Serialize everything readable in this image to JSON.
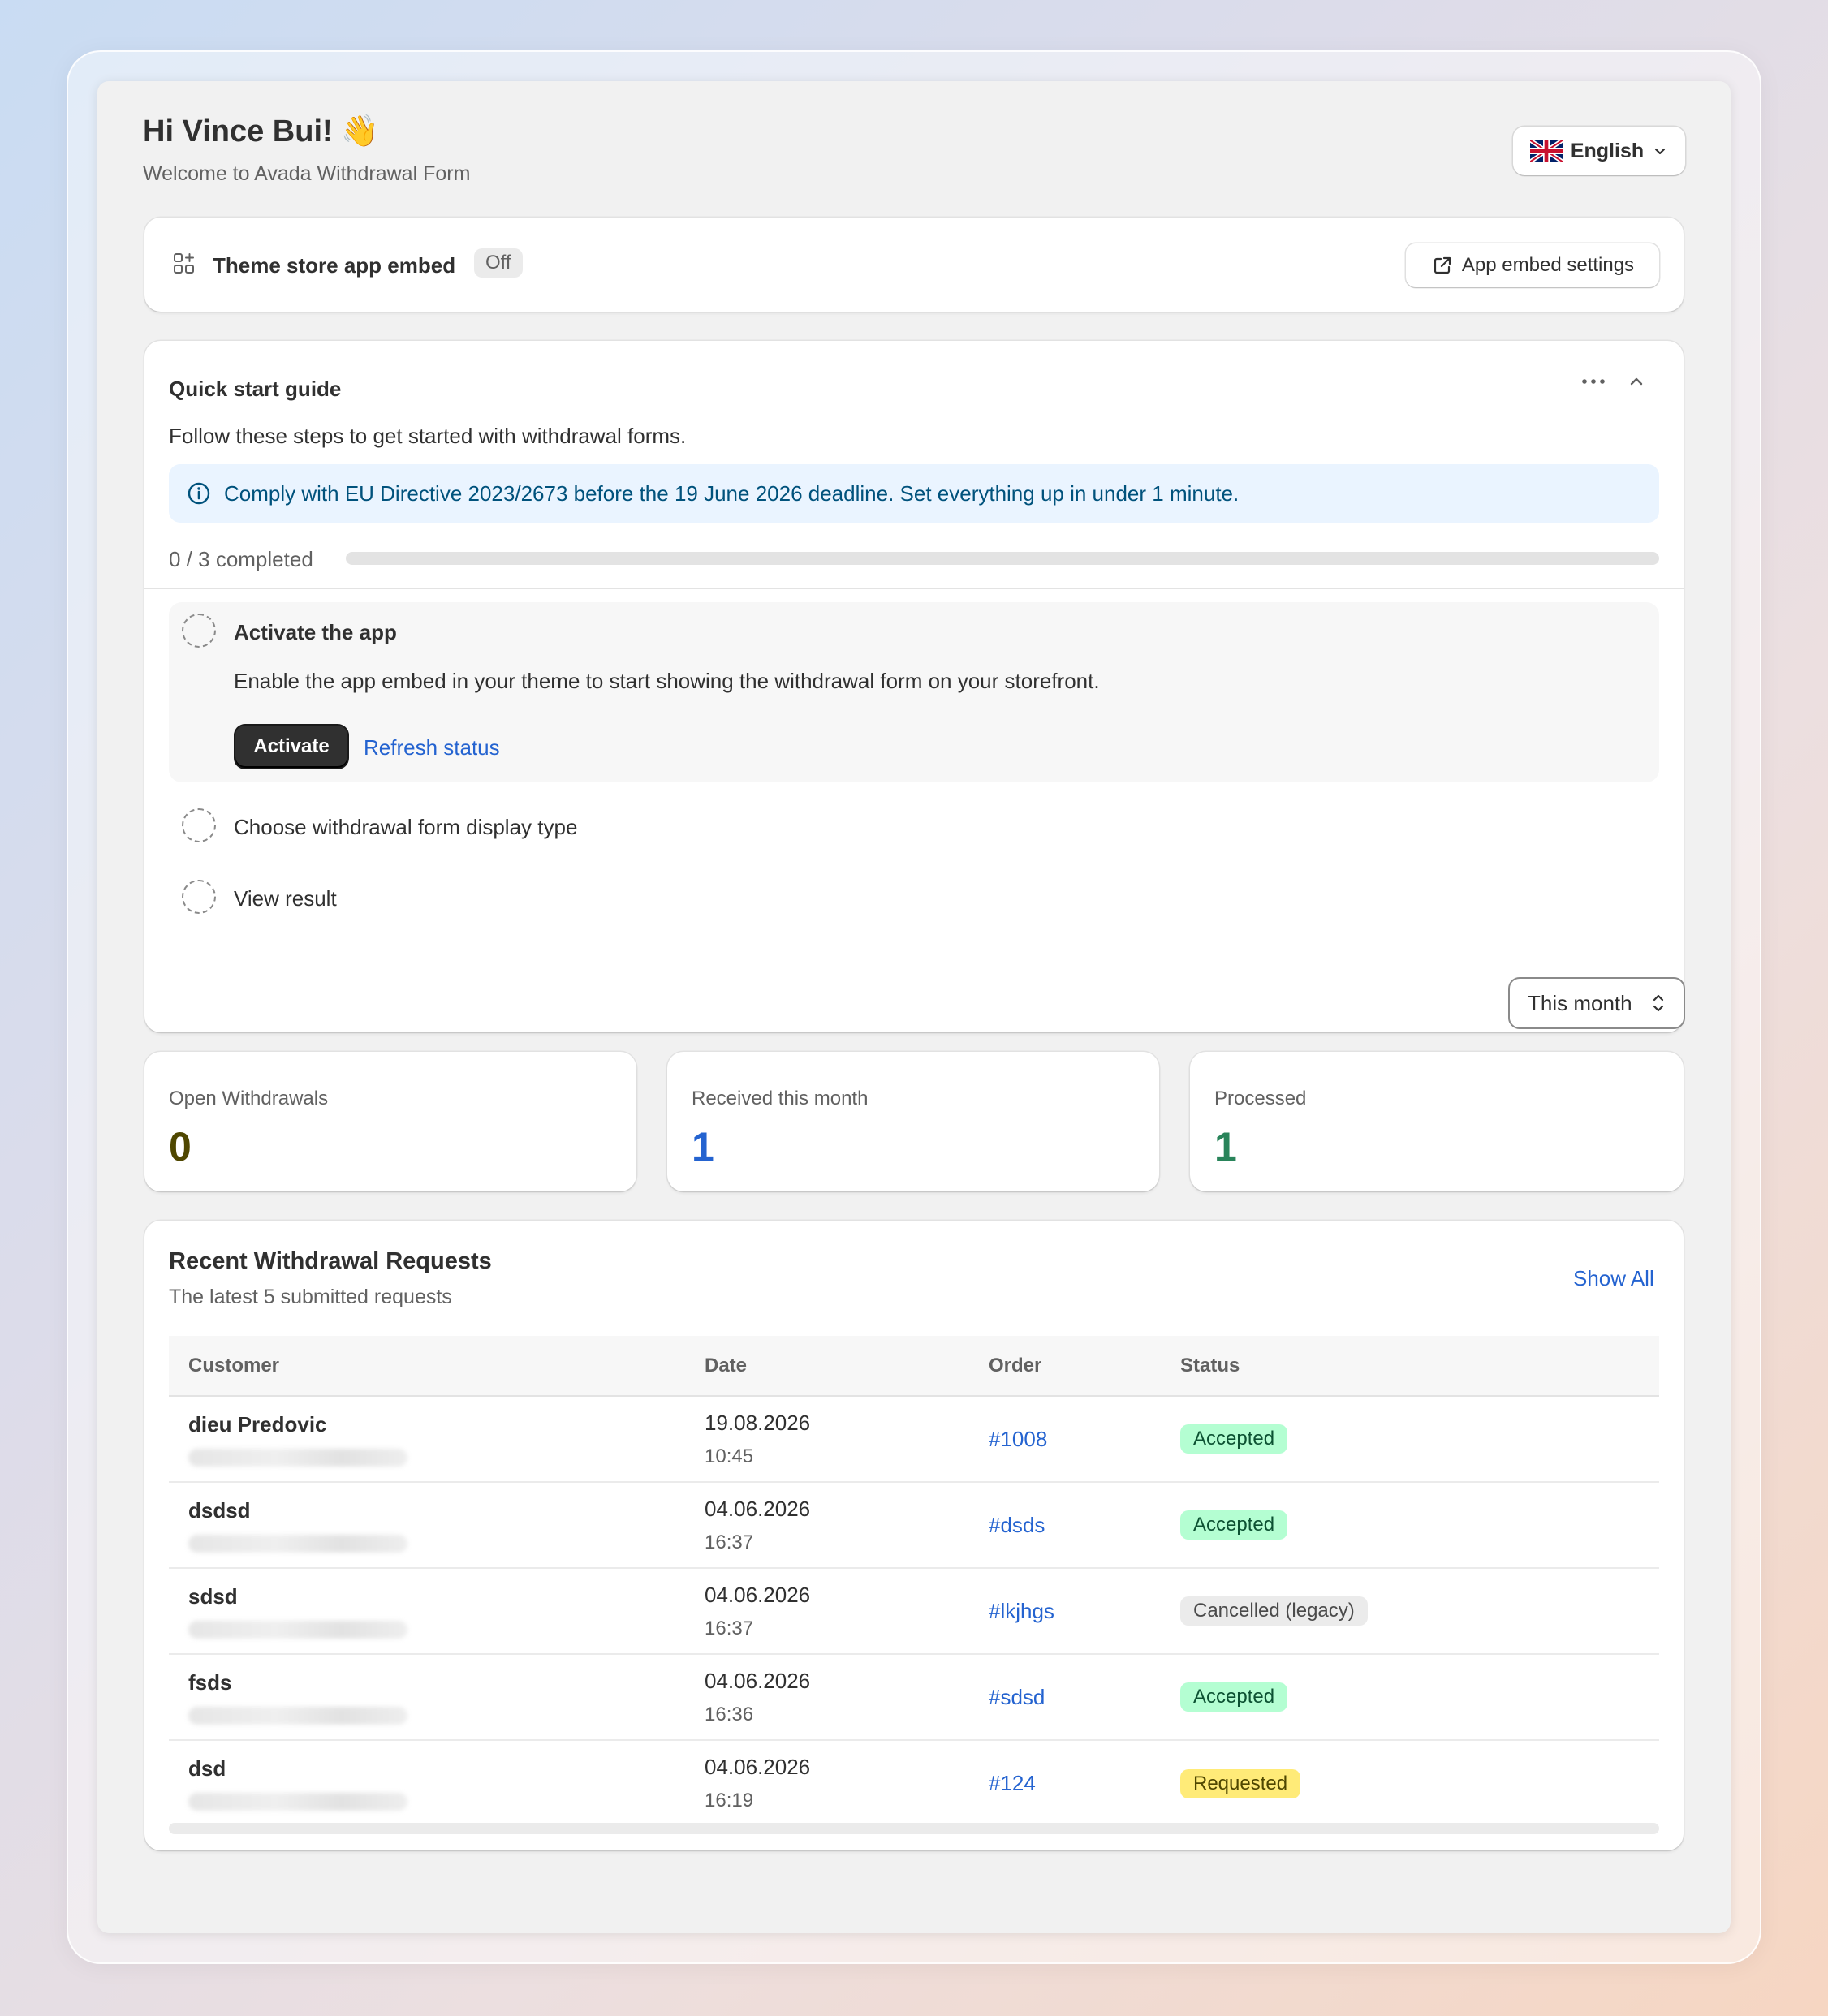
{
  "header": {
    "greeting": "Hi Vince Bui!",
    "greeting_emoji": "👋",
    "welcome": "Welcome to Avada Withdrawal Form",
    "language": "English",
    "language_icon": "uk-flag-icon"
  },
  "embed": {
    "title": "Theme store app embed",
    "status": "Off",
    "settings_label": "App embed settings"
  },
  "guide": {
    "title": "Quick start guide",
    "description": "Follow these steps to get started with withdrawal forms.",
    "banner": "Comply with EU Directive 2023/2673 before the 19 June 2026 deadline. Set everything up in under 1 minute.",
    "progress_text": "0 / 3 completed",
    "progress_completed": 0,
    "progress_total": 3,
    "steps": [
      {
        "title": "Activate the app",
        "description": "Enable the app embed in your theme to start showing the withdrawal form on your storefront.",
        "primary_action": "Activate",
        "secondary_action": "Refresh status"
      },
      {
        "title": "Choose withdrawal form display type"
      },
      {
        "title": "View result"
      }
    ]
  },
  "filter": {
    "period": "This month"
  },
  "stats": {
    "open": {
      "label": "Open Withdrawals",
      "value": "0",
      "color": "#4f4700"
    },
    "received": {
      "label": "Received this month",
      "value": "1",
      "color": "#2463d0"
    },
    "processed": {
      "label": "Processed",
      "value": "1",
      "color": "#29845a"
    }
  },
  "recent": {
    "title": "Recent Withdrawal Requests",
    "subtitle": "The latest 5 submitted requests",
    "show_all": "Show All",
    "columns": [
      "Customer",
      "Date",
      "Order",
      "Status"
    ],
    "rows": [
      {
        "customer": "dieu Predovic",
        "date": "19.08.2026",
        "time": "10:45",
        "order": "#1008",
        "status": "Accepted"
      },
      {
        "customer": "dsdsd",
        "date": "04.06.2026",
        "time": "16:37",
        "order": "#dsds",
        "status": "Accepted"
      },
      {
        "customer": "sdsd",
        "date": "04.06.2026",
        "time": "16:37",
        "order": "#lkjhgs",
        "status": "Cancelled (legacy)"
      },
      {
        "customer": "fsds",
        "date": "04.06.2026",
        "time": "16:36",
        "order": "#sdsd",
        "status": "Accepted"
      },
      {
        "customer": "dsd",
        "date": "04.06.2026",
        "time": "16:19",
        "order": "#124",
        "status": "Requested"
      }
    ]
  }
}
